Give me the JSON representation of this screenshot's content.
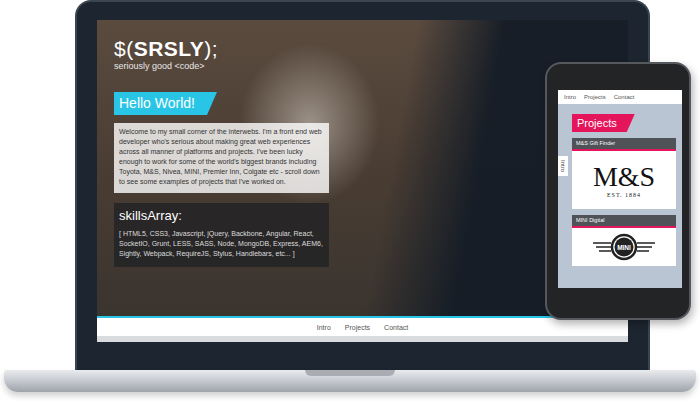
{
  "site": {
    "logo": {
      "prefix": "$(",
      "name": "SRSLY",
      "suffix": ");",
      "tagline": "seriously good <code>"
    },
    "greeting": "Hello World!",
    "intro": "Welcome to my small corner of the interwebs. I'm a front end web developer who's serious about making great web experiences across all manner of platforms and projects. I've been lucky enough to work for some of the world's biggest brands including Toyota, M&S, Nivea, MINI, Premier Inn, Colgate etc - scroll down to see some examples of projects that I've worked on.",
    "skills_title": "skillsArray:",
    "skills": "[ HTML5, CSS3, Javascript, jQuery, Backbone, Angular, React, SocketIO, Grunt, LESS, SASS, Node, MongoDB, Express, AEM6, Sightly, Webpack, RequireJS, Stylus, Handlebars, etc... ]",
    "nav": [
      {
        "label": "Intro"
      },
      {
        "label": "Projects"
      },
      {
        "label": "Contact"
      }
    ]
  },
  "phone": {
    "nav": [
      {
        "label": "Intro"
      },
      {
        "label": "Projects"
      },
      {
        "label": "Contact"
      }
    ],
    "side_tab": "Intro",
    "section_title": "Projects",
    "projects": [
      {
        "title": "M&S Gift Finder",
        "kind": "wordmark",
        "logo_text": "M&S",
        "logo_subtext": "EST. 1884"
      },
      {
        "title": "MINI Digital",
        "kind": "badge",
        "logo_text": "MINI"
      }
    ]
  }
}
